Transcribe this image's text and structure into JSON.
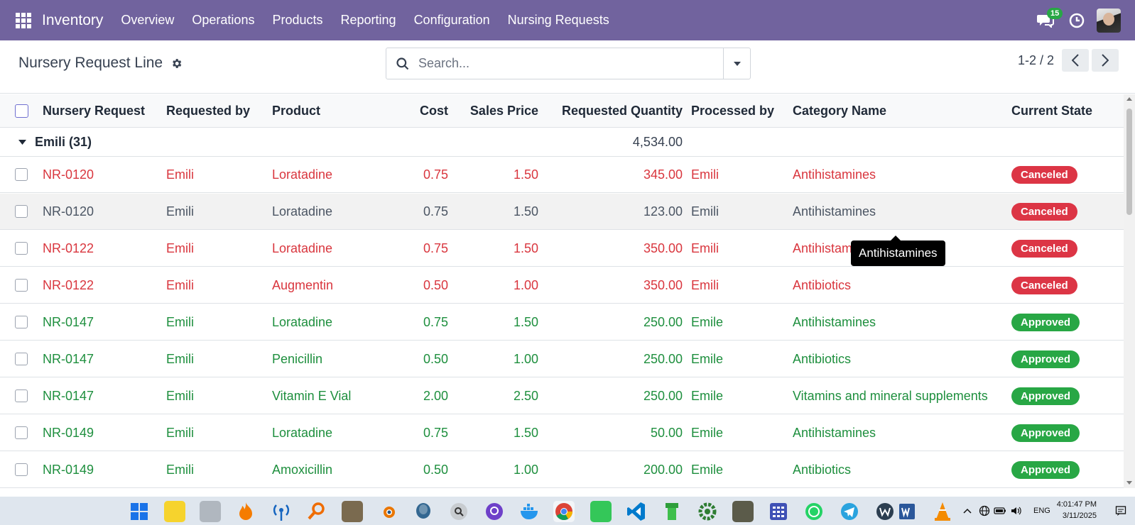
{
  "nav": {
    "app_name": "Inventory",
    "menu": [
      "Overview",
      "Operations",
      "Products",
      "Reporting",
      "Configuration",
      "Nursing Requests"
    ],
    "messages_count": "15"
  },
  "control": {
    "title": "Nursery Request Line",
    "search_placeholder": "Search...",
    "pager": "1-2 / 2"
  },
  "table": {
    "headers": {
      "nursery_request": "Nursery Request",
      "requested_by": "Requested by",
      "product": "Product",
      "cost": "Cost",
      "sales_price": "Sales Price",
      "requested_quantity": "Requested Quantity",
      "processed_by": "Processed by",
      "category_name": "Category Name",
      "current_state": "Current State"
    },
    "group": {
      "label": "Emili (31)",
      "total_quantity": "4,534.00"
    },
    "rows": [
      {
        "request": "NR-0120",
        "requested_by": "Emili",
        "product": "Loratadine",
        "cost": "0.75",
        "price": "1.50",
        "qty": "345.00",
        "processed_by": "Emili",
        "category": "Antihistamines",
        "state": "Canceled"
      },
      {
        "request": "NR-0120",
        "requested_by": "Emili",
        "product": "Loratadine",
        "cost": "0.75",
        "price": "1.50",
        "qty": "123.00",
        "processed_by": "Emili",
        "category": "Antihistamines",
        "state": "Canceled"
      },
      {
        "request": "NR-0122",
        "requested_by": "Emili",
        "product": "Loratadine",
        "cost": "0.75",
        "price": "1.50",
        "qty": "350.00",
        "processed_by": "Emili",
        "category": "Antihistam",
        "state": "Canceled"
      },
      {
        "request": "NR-0122",
        "requested_by": "Emili",
        "product": "Augmentin",
        "cost": "0.50",
        "price": "1.00",
        "qty": "350.00",
        "processed_by": "Emili",
        "category": "Antibiotics",
        "state": "Canceled"
      },
      {
        "request": "NR-0147",
        "requested_by": "Emili",
        "product": "Loratadine",
        "cost": "0.75",
        "price": "1.50",
        "qty": "250.00",
        "processed_by": "Emile",
        "category": "Antihistamines",
        "state": "Approved"
      },
      {
        "request": "NR-0147",
        "requested_by": "Emili",
        "product": "Penicillin",
        "cost": "0.50",
        "price": "1.00",
        "qty": "250.00",
        "processed_by": "Emile",
        "category": "Antibiotics",
        "state": "Approved"
      },
      {
        "request": "NR-0147",
        "requested_by": "Emili",
        "product": "Vitamin E Vial",
        "cost": "2.00",
        "price": "2.50",
        "qty": "250.00",
        "processed_by": "Emile",
        "category": "Vitamins and mineral supplements",
        "state": "Approved"
      },
      {
        "request": "NR-0149",
        "requested_by": "Emili",
        "product": "Loratadine",
        "cost": "0.75",
        "price": "1.50",
        "qty": "50.00",
        "processed_by": "Emile",
        "category": "Antihistamines",
        "state": "Approved"
      },
      {
        "request": "NR-0149",
        "requested_by": "Emili",
        "product": "Amoxicillin",
        "cost": "0.50",
        "price": "1.00",
        "qty": "200.00",
        "processed_by": "Emile",
        "category": "Antibiotics",
        "state": "Approved"
      }
    ]
  },
  "tooltip": "Antihistamines",
  "taskbar": {
    "language": "ENG",
    "time": "4:01:47 PM",
    "date": "3/11/2025"
  }
}
